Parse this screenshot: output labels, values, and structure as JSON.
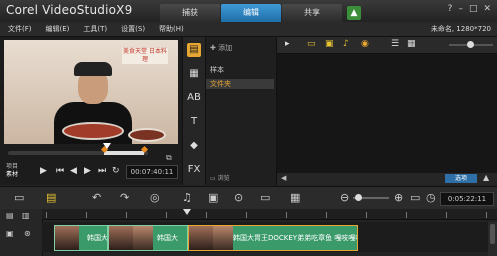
{
  "title_bar": {
    "logo": "Corel VideoStudioX9",
    "tabs": [
      "捕获",
      "编辑",
      "共享"
    ],
    "active_tab": "编辑",
    "window_controls": [
      "?",
      "–",
      "□",
      "✕"
    ]
  },
  "menu": {
    "items": [
      "文件(F)",
      "编辑(E)",
      "工具(T)",
      "设置(S)",
      "帮助(H)"
    ],
    "project_info": "未命名, 1280*720"
  },
  "player": {
    "overlay_text": "美食天堂 日本料理",
    "mode_labels": [
      "项目",
      "素材"
    ],
    "timecode": "00:07:40:11"
  },
  "library": {
    "add_label": "添加",
    "folders_header": "样本",
    "folders": [
      "文件夹"
    ],
    "browse_label": "浏览",
    "options_label": "选项"
  },
  "timeline": {
    "timecode": "0:05:22:11",
    "clips": [
      {
        "label": "韩国大",
        "selected": false
      },
      {
        "label": "韩国大",
        "selected": false
      },
      {
        "label": "韩国大胃王DOCKEY弟弟吃章鱼 嘎吱嘎吱",
        "selected": true
      }
    ]
  },
  "colors": {
    "accent_blue": "#2f7fc0",
    "clip_green": "#3a9a6a",
    "highlight_orange": "#e7a531"
  }
}
